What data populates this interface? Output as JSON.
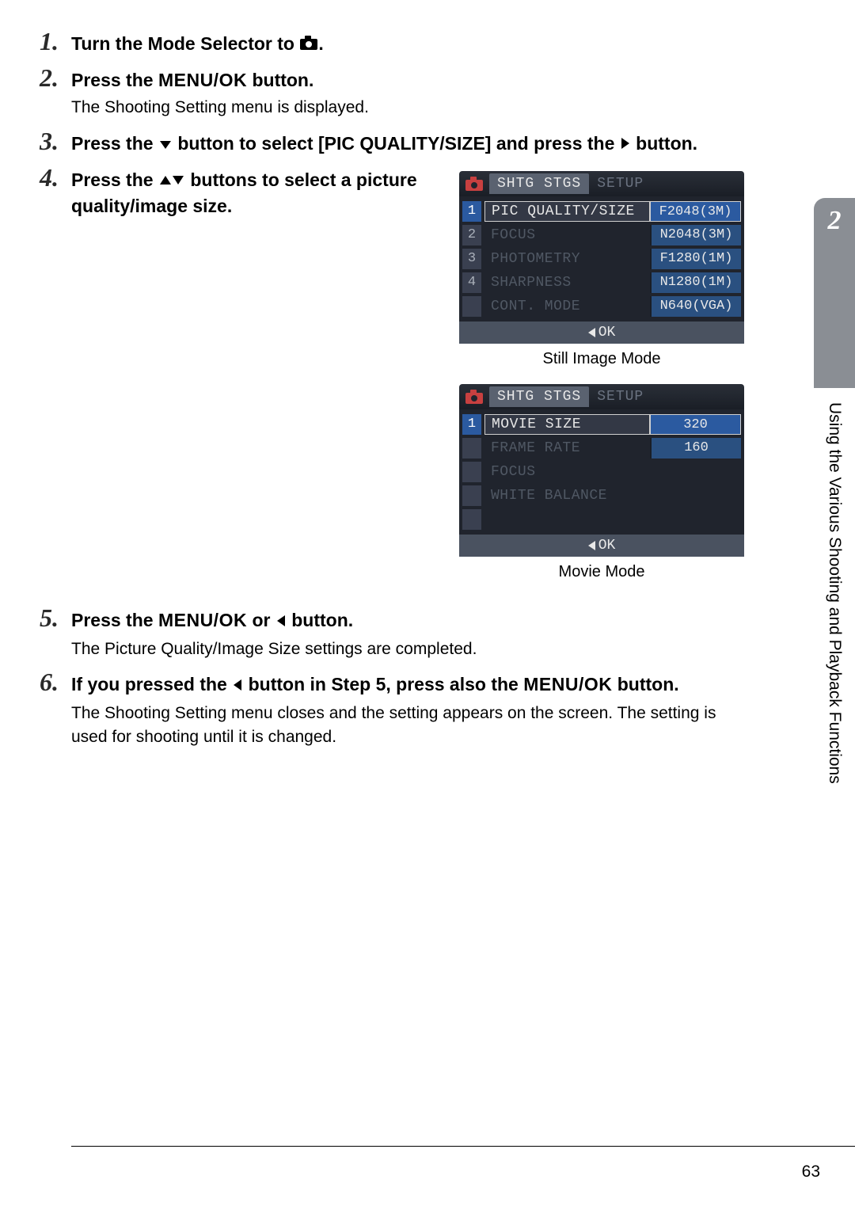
{
  "steps": {
    "s1": {
      "num": "1.",
      "title_pre": "Turn the Mode Selector to ",
      "title_post": "."
    },
    "s2": {
      "num": "2.",
      "title_pre": "Press the ",
      "menuok": "MENU/OK",
      "title_post": " button.",
      "desc": "The Shooting Setting menu is displayed."
    },
    "s3": {
      "num": "3.",
      "title_pre": "Press the ",
      "title_mid": " button to select [PIC QUALITY/SIZE] and press the ",
      "title_post": " button."
    },
    "s4": {
      "num": "4.",
      "title_pre": "Press the ",
      "title_post": " buttons to select a picture quality/image size."
    },
    "s5": {
      "num": "5.",
      "title_pre": "Press the ",
      "menuok": "MENU/OK",
      "title_mid": " or ",
      "title_post": " button.",
      "desc": "The Picture Quality/Image Size settings are completed."
    },
    "s6": {
      "num": "6.",
      "title_pre": "If you pressed the ",
      "title_mid": " button in Step 5, press also the ",
      "menuok": "MENU/OK",
      "title_post": " button.",
      "desc": "The Shooting Setting menu closes and the setting appears on the screen. The setting is used for shooting until it is changed."
    }
  },
  "screen_still": {
    "tab_active": "SHTG STGS",
    "tab_inactive": "SETUP",
    "rows": [
      {
        "num": "1",
        "label": "PIC QUALITY/SIZE",
        "val": "F2048(3M)",
        "selected": true
      },
      {
        "num": "2",
        "label": "FOCUS",
        "val": "N2048(3M)"
      },
      {
        "num": "3",
        "label": "PHOTOMETRY",
        "val": "F1280(1M)"
      },
      {
        "num": "4",
        "label": "SHARPNESS",
        "val": "N1280(1M)"
      },
      {
        "num": "",
        "label": "CONT. MODE",
        "val": "N640(VGA)"
      }
    ],
    "footer": "OK",
    "caption": "Still Image Mode"
  },
  "screen_movie": {
    "tab_active": "SHTG STGS",
    "tab_inactive": "SETUP",
    "rows": [
      {
        "num": "1",
        "label": "MOVIE SIZE",
        "val": "320",
        "selected": true
      },
      {
        "num": "",
        "label": "FRAME RATE",
        "val": "160"
      },
      {
        "num": "",
        "label": "FOCUS",
        "val": ""
      },
      {
        "num": "",
        "label": "WHITE BALANCE",
        "val": ""
      },
      {
        "num": "",
        "label": "",
        "val": ""
      }
    ],
    "footer": "OK",
    "caption": "Movie Mode"
  },
  "side": {
    "chapter": "2",
    "title": "Using the Various Shooting and Playback Functions"
  },
  "page_number": "63"
}
